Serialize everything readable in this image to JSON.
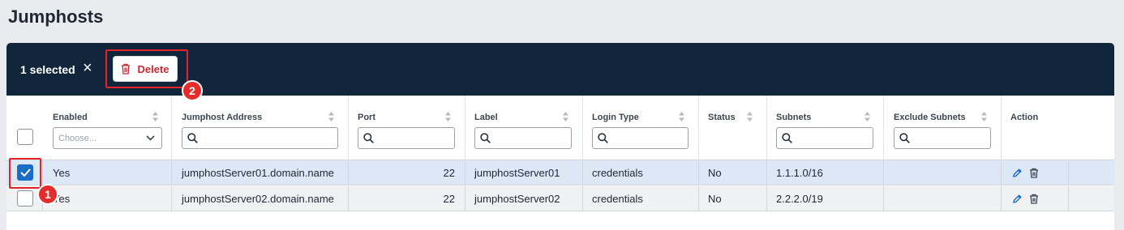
{
  "page": {
    "title": "Jumphosts"
  },
  "selection": {
    "count_label": "1 selected",
    "clear_label": "×",
    "delete_label": "Delete"
  },
  "columns": {
    "enabled": "Enabled",
    "address": "Jumphost Address",
    "port": "Port",
    "label": "Label",
    "login_type": "Login Type",
    "status": "Status",
    "subnets": "Subnets",
    "exclude_subnets": "Exclude Subnets",
    "action": "Action"
  },
  "filters": {
    "enabled_placeholder": "Choose..."
  },
  "rows": [
    {
      "enabled": "Yes",
      "address": "jumphostServer01.domain.name",
      "port": "22",
      "label": "jumphostServer01",
      "login_type": "credentials",
      "status": "No",
      "subnets": "1.1.1.0/16",
      "exclude_subnets": "",
      "selected": true
    },
    {
      "enabled": "Yes",
      "address": "jumphostServer02.domain.name",
      "port": "22",
      "label": "jumphostServer02",
      "login_type": "credentials",
      "status": "No",
      "subnets": "2.2.2.0/19",
      "exclude_subnets": "",
      "selected": false
    }
  ],
  "annotations": [
    {
      "label": "1"
    },
    {
      "label": "2"
    }
  ],
  "colors": {
    "header_bar": "#12263b",
    "accent": "#1a6dc4",
    "danger": "#c62832",
    "annotation": "#e62b2b"
  }
}
